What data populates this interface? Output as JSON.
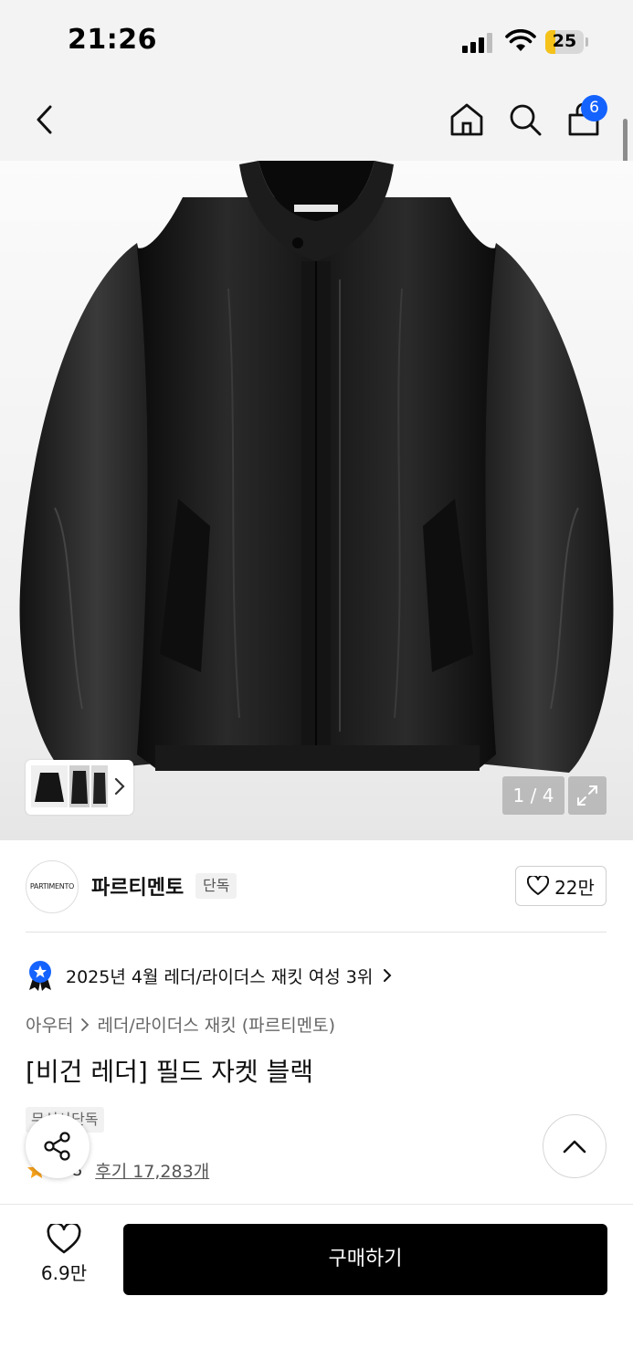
{
  "status_bar": {
    "time": "21:26",
    "battery": "25",
    "battery_level": 0.25
  },
  "nav": {
    "back_icon": "chevron-left-icon",
    "home_icon": "home-icon",
    "search_icon": "search-icon",
    "cart_icon": "shopping-bag-icon",
    "cart_count": "6"
  },
  "gallery": {
    "counter": "1 / 4",
    "current": 1,
    "total": 4,
    "expand_icon": "expand-icon"
  },
  "brand": {
    "logo_text": "PARTIMENTO",
    "name": "파르티멘토",
    "tag": "단독",
    "likes": "22만"
  },
  "ranking": {
    "text": "2025년 4월 레더/라이더스 재킷 여성 3위"
  },
  "breadcrumb": {
    "category": "아우터",
    "subcategory": "레더/라이더스 재킷 (파르티멘토)"
  },
  "product": {
    "title": "[비건 레더] 필드 자켓 블랙",
    "exclusive": "무신사단독",
    "rating": "4.8",
    "reviews": "후기 17,283개"
  },
  "bottom": {
    "wish_count": "6.9만",
    "buy_label": "구매하기"
  },
  "colors": {
    "accent": "#1463ff",
    "battery": "#f4c21a",
    "star": "#f7a21b",
    "buy": "#000000"
  }
}
